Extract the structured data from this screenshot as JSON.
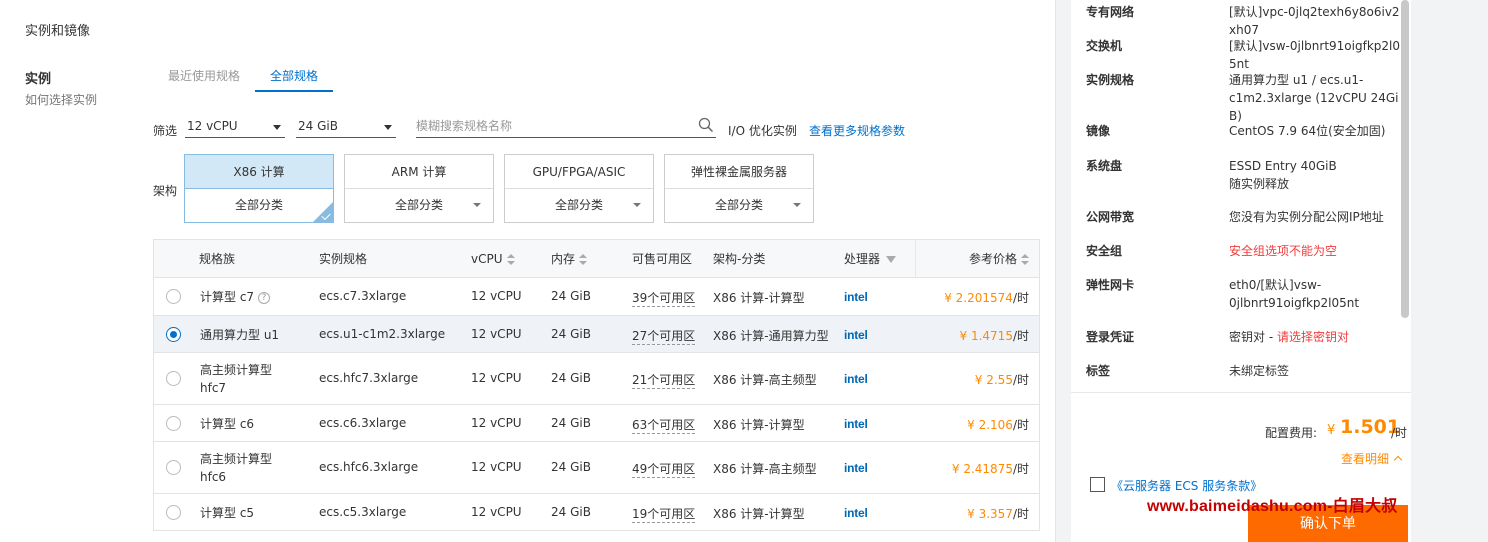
{
  "section_title": "实例和镜像",
  "instance_label": "实例",
  "instance_help": "如何选择实例",
  "tabs": [
    {
      "label": "最近使用规格",
      "active": false
    },
    {
      "label": "全部规格",
      "active": true
    }
  ],
  "filter": {
    "label": "筛选",
    "cpu": "12 vCPU",
    "memory": "24 GiB",
    "search_placeholder": "模糊搜索规格名称",
    "io_label": "I/O 优化实例",
    "more_link": "查看更多规格参数"
  },
  "arch": {
    "label": "架构",
    "cards": [
      {
        "name": "X86 计算",
        "sub": "全部分类",
        "active": true
      },
      {
        "name": "ARM 计算",
        "sub": "全部分类",
        "active": false
      },
      {
        "name": "GPU/FPGA/ASIC",
        "sub": "全部分类",
        "active": false
      },
      {
        "name": "弹性裸金属服务器",
        "sub": "全部分类",
        "active": false
      }
    ]
  },
  "table": {
    "headers": {
      "family": "规格族",
      "spec": "实例规格",
      "vcpu": "vCPU",
      "memory": "内存",
      "zones": "可售可用区",
      "arch": "架构-分类",
      "cpu": "处理器",
      "price": "参考价格"
    },
    "rows": [
      {
        "family": [
          "计算型 c7"
        ],
        "help": "?",
        "spec": "ecs.c7.3xlarge",
        "vcpu": "12 vCPU",
        "mem": "24 GiB",
        "zones": "39个可用区",
        "arch": "X86 计算-计算型",
        "cpu": "intel",
        "price": "¥ 2.201574",
        "unit": "/时",
        "selected": false
      },
      {
        "family": [
          "通用算力型 u1"
        ],
        "spec": "ecs.u1-c1m2.3xlarge",
        "vcpu": "12 vCPU",
        "mem": "24 GiB",
        "zones": "27个可用区",
        "arch": "X86 计算-通用算力型",
        "cpu": "intel",
        "price": "¥ 1.4715",
        "unit": "/时",
        "selected": true
      },
      {
        "family": [
          "高主频计算型",
          "hfc7"
        ],
        "spec": "ecs.hfc7.3xlarge",
        "vcpu": "12 vCPU",
        "mem": "24 GiB",
        "zones": "21个可用区",
        "arch": "X86 计算-高主频型",
        "cpu": "intel",
        "price": "¥ 2.55",
        "unit": "/时",
        "selected": false
      },
      {
        "family": [
          "计算型 c6"
        ],
        "spec": "ecs.c6.3xlarge",
        "vcpu": "12 vCPU",
        "mem": "24 GiB",
        "zones": "63个可用区",
        "arch": "X86 计算-计算型",
        "cpu": "intel",
        "price": "¥ 2.106",
        "unit": "/时",
        "selected": false
      },
      {
        "family": [
          "高主频计算型",
          "hfc6"
        ],
        "spec": "ecs.hfc6.3xlarge",
        "vcpu": "12 vCPU",
        "mem": "24 GiB",
        "zones": "49个可用区",
        "arch": "X86 计算-高主频型",
        "cpu": "intel",
        "price": "¥ 2.41875",
        "unit": "/时",
        "selected": false
      },
      {
        "family": [
          "计算型 c5"
        ],
        "spec": "ecs.c5.3xlarge",
        "vcpu": "12 vCPU",
        "mem": "24 GiB",
        "zones": "19个可用区",
        "arch": "X86 计算-计算型",
        "cpu": "intel",
        "price": "¥ 3.357",
        "unit": "/时",
        "selected": false
      }
    ]
  },
  "summary": [
    {
      "key": "专有网络",
      "lines": [
        "[默认]vpc-0jlq2texh6y8o6iv2xh07"
      ]
    },
    {
      "key": "交换机",
      "lines": [
        "[默认]vsw-0jlbnrt91oigfkp2l05nt"
      ]
    },
    {
      "key": "实例规格",
      "lines": [
        "通用算力型 u1 / ecs.u1-",
        "c1m2.3xlarge (12vCPU 24GiB)"
      ]
    },
    {
      "key": "镜像",
      "lines": [
        "CentOS 7.9 64位(安全加固)"
      ]
    },
    {
      "key": "系统盘",
      "lines": [
        "ESSD Entry 40GiB",
        "随实例释放"
      ]
    },
    {
      "key": "公网带宽",
      "lines": [
        "您没有为实例分配公网IP地址"
      ]
    },
    {
      "key": "安全组",
      "lines": [
        "安全组选项不能为空"
      ],
      "red": true
    },
    {
      "key": "弹性网卡",
      "lines": [
        "eth0/[默认]vsw-",
        "0jlbnrt91oigfkp2l05nt"
      ]
    },
    {
      "key": "登录凭证",
      "lines": [
        "密钥对 - "
      ],
      "extra_red": "请选择密钥对"
    },
    {
      "key": "标签",
      "lines": [
        "未绑定标签"
      ]
    }
  ],
  "fee": {
    "label": "配置费用:",
    "currency": "¥",
    "value": "1.501",
    "unit": "/时",
    "detail_link": "查看明细"
  },
  "terms_link": "《云服务器 ECS 服务条款》",
  "order_button": "确认下单",
  "watermark": "www.baimeidashu.com-白眉大叔",
  "colors": {
    "accent": "#0070cc",
    "price": "#ff8a00",
    "order": "#ff6a00",
    "error": "#f23c3c"
  }
}
